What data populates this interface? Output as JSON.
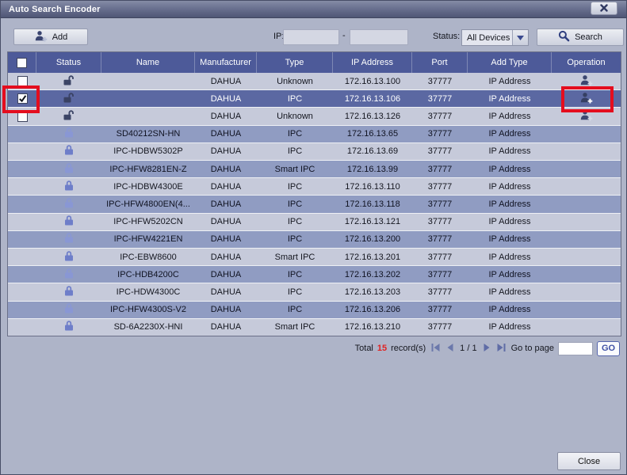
{
  "window": {
    "title": "Auto Search Encoder",
    "close_icon": "x-icon"
  },
  "toolbar": {
    "add_label": "Add",
    "add_icon": "user-plus-icon",
    "ip_label": "IP:",
    "ip_from_value": "",
    "ip_separator": "-",
    "ip_to_value": "",
    "status_label": "Status:",
    "status_value": "All Devices",
    "status_dropdown_icon": "caret-down-icon",
    "search_label": "Search",
    "search_icon": "magnifier-icon"
  },
  "table": {
    "columns": [
      "",
      "Status",
      "Name",
      "Manufacturer",
      "Type",
      "IP Address",
      "Port",
      "Add Type",
      "Operation"
    ],
    "status_icons": {
      "unlocked": "lock-open-icon",
      "locked": "lock-closed-icon"
    },
    "operation_icon": "user-plus-icon",
    "rows": [
      {
        "checkbox": "unchecked",
        "status": "unlocked",
        "name": "",
        "manufacturer": "DAHUA",
        "type": "Unknown",
        "ip": "172.16.13.100",
        "port": "37777",
        "add_type": "IP Address",
        "operation": "add",
        "selected": false
      },
      {
        "checkbox": "checked",
        "status": "unlocked",
        "name": "",
        "manufacturer": "DAHUA",
        "type": "IPC",
        "ip": "172.16.13.106",
        "port": "37777",
        "add_type": "IP Address",
        "operation": "add",
        "selected": true
      },
      {
        "checkbox": "unchecked",
        "status": "unlocked",
        "name": "",
        "manufacturer": "DAHUA",
        "type": "Unknown",
        "ip": "172.16.13.126",
        "port": "37777",
        "add_type": "IP Address",
        "operation": "add",
        "selected": false
      },
      {
        "checkbox": "none",
        "status": "locked",
        "name": "SD40212SN-HN",
        "manufacturer": "DAHUA",
        "type": "IPC",
        "ip": "172.16.13.65",
        "port": "37777",
        "add_type": "IP Address",
        "operation": "",
        "selected": false
      },
      {
        "checkbox": "none",
        "status": "locked",
        "name": "IPC-HDBW5302P",
        "manufacturer": "DAHUA",
        "type": "IPC",
        "ip": "172.16.13.69",
        "port": "37777",
        "add_type": "IP Address",
        "operation": "",
        "selected": false
      },
      {
        "checkbox": "none",
        "status": "locked",
        "name": "IPC-HFW8281EN-Z",
        "manufacturer": "DAHUA",
        "type": "Smart IPC",
        "ip": "172.16.13.99",
        "port": "37777",
        "add_type": "IP Address",
        "operation": "",
        "selected": false
      },
      {
        "checkbox": "none",
        "status": "locked",
        "name": "IPC-HDBW4300E",
        "manufacturer": "DAHUA",
        "type": "IPC",
        "ip": "172.16.13.110",
        "port": "37777",
        "add_type": "IP Address",
        "operation": "",
        "selected": false
      },
      {
        "checkbox": "none",
        "status": "locked",
        "name": "IPC-HFW4800EN(4...",
        "manufacturer": "DAHUA",
        "type": "IPC",
        "ip": "172.16.13.118",
        "port": "37777",
        "add_type": "IP Address",
        "operation": "",
        "selected": false
      },
      {
        "checkbox": "none",
        "status": "locked",
        "name": "IPC-HFW5202CN",
        "manufacturer": "DAHUA",
        "type": "IPC",
        "ip": "172.16.13.121",
        "port": "37777",
        "add_type": "IP Address",
        "operation": "",
        "selected": false
      },
      {
        "checkbox": "none",
        "status": "locked",
        "name": "IPC-HFW4221EN",
        "manufacturer": "DAHUA",
        "type": "IPC",
        "ip": "172.16.13.200",
        "port": "37777",
        "add_type": "IP Address",
        "operation": "",
        "selected": false
      },
      {
        "checkbox": "none",
        "status": "locked",
        "name": "IPC-EBW8600",
        "manufacturer": "DAHUA",
        "type": "Smart IPC",
        "ip": "172.16.13.201",
        "port": "37777",
        "add_type": "IP Address",
        "operation": "",
        "selected": false
      },
      {
        "checkbox": "none",
        "status": "locked",
        "name": "IPC-HDB4200C",
        "manufacturer": "DAHUA",
        "type": "IPC",
        "ip": "172.16.13.202",
        "port": "37777",
        "add_type": "IP Address",
        "operation": "",
        "selected": false
      },
      {
        "checkbox": "none",
        "status": "locked",
        "name": "IPC-HDW4300C",
        "manufacturer": "DAHUA",
        "type": "IPC",
        "ip": "172.16.13.203",
        "port": "37777",
        "add_type": "IP Address",
        "operation": "",
        "selected": false
      },
      {
        "checkbox": "none",
        "status": "locked",
        "name": "IPC-HFW4300S-V2",
        "manufacturer": "DAHUA",
        "type": "IPC",
        "ip": "172.16.13.206",
        "port": "37777",
        "add_type": "IP Address",
        "operation": "",
        "selected": false
      },
      {
        "checkbox": "none",
        "status": "locked",
        "name": "SD-6A2230X-HNI",
        "manufacturer": "DAHUA",
        "type": "Smart IPC",
        "ip": "172.16.13.210",
        "port": "37777",
        "add_type": "IP Address",
        "operation": "",
        "selected": false
      }
    ]
  },
  "pagination": {
    "total_label": "Total",
    "total_count": "15",
    "records_label": "record(s)",
    "first_icon": "first-page-icon",
    "prev_icon": "prev-page-icon",
    "page_indicator": "1 / 1",
    "next_icon": "next-page-icon",
    "last_icon": "last-page-icon",
    "goto_label": "Go to page",
    "goto_value": "",
    "go_label": "GO"
  },
  "footer": {
    "close_label": "Close"
  },
  "annotations": [
    {
      "name": "highlight-rect-checkbox",
      "row": 2,
      "column": "checkbox",
      "color": "#e40d1e"
    },
    {
      "name": "highlight-rect-operation",
      "row": 2,
      "column": "operation",
      "color": "#e40d1e"
    }
  ],
  "colors": {
    "header_bg": "#4d5a99",
    "row_light": "#c6cada",
    "row_dark": "#909cc2",
    "row_selected": "#5b68a2",
    "body_bg": "#aeb4c8",
    "lock_blue": "#6e7ec9",
    "annotation_red": "#e40d1e",
    "total_count_red": "#e02323"
  }
}
